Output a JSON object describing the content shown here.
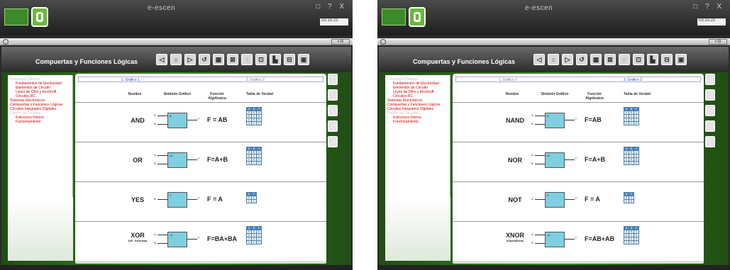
{
  "app_brand": "e-escen",
  "window_buttons": "□ ? X",
  "toolbar_zoom": "◐⊟",
  "lesson_title": "Compuertas y Funciones Lógicas",
  "nav_buttons": [
    "◁",
    "⌂",
    "▷",
    "↺",
    "▦",
    "⊠",
    "◌",
    "⊡",
    "▙",
    "⊟",
    "▣"
  ],
  "headers": {
    "name": "Nombre",
    "symbol": "Símbolo Gráfico",
    "function": "Función Algebraica",
    "table": "Tabla de Verdad"
  },
  "sidebar": [
    {
      "text": "Conceptos Básicos",
      "cls": "g"
    },
    {
      "text": "Fundamentos de Electricidad",
      "cls": "s"
    },
    {
      "text": "Elementos de Circuito",
      "cls": "s"
    },
    {
      "text": "Leyes de Ohm y Kirchhoff",
      "cls": "s"
    },
    {
      "text": "Circuitos RC",
      "cls": "s"
    },
    {
      "text": "Sistemas Electrónicos",
      "cls": ""
    },
    {
      "text": "Compuertas y Funciones Lógicas",
      "cls": ""
    },
    {
      "text": "Circuitos Integrados Digitales",
      "cls": ""
    },
    {
      "text": "Diseño de Circuitos",
      "cls": "g"
    },
    {
      "text": "Estructura Interna",
      "cls": "s"
    },
    {
      "text": "Funcionamiento",
      "cls": "s"
    }
  ],
  "screens": [
    {
      "timer": "03:15:22",
      "tabs": [
        "1. Gráfico 1",
        "2. Gráfico 2"
      ],
      "active_tab": 0,
      "gates": [
        {
          "name": "AND",
          "sub": "",
          "box": "&",
          "expr": "F = AB",
          "rows": [
            [
              "A",
              "B",
              "F"
            ],
            [
              "0",
              "0",
              "0"
            ],
            [
              "0",
              "1",
              "0"
            ],
            [
              "1",
              "0",
              "0"
            ],
            [
              "1",
              "1",
              "1"
            ]
          ]
        },
        {
          "name": "OR",
          "sub": "",
          "box": "≥1",
          "expr": "F=A+B",
          "rows": [
            [
              "A",
              "B",
              "F"
            ],
            [
              "0",
              "0",
              "0"
            ],
            [
              "0",
              "1",
              "1"
            ],
            [
              "1",
              "0",
              "1"
            ],
            [
              "1",
              "1",
              "1"
            ]
          ]
        },
        {
          "name": "YES",
          "sub": "",
          "box": "1",
          "expr": "F = A",
          "rows": [
            [
              "A",
              "F"
            ],
            [
              "0",
              "0"
            ],
            [
              "1",
              "1"
            ]
          ]
        },
        {
          "name": "XOR",
          "sub": "(OR - Exclusiva)",
          "box": "=1",
          "expr": "F=BA+BA",
          "rows": [
            [
              "A",
              "B",
              "F"
            ],
            [
              "0",
              "0",
              "0"
            ],
            [
              "0",
              "1",
              "1"
            ],
            [
              "1",
              "0",
              "1"
            ],
            [
              "1",
              "1",
              "0"
            ]
          ]
        }
      ]
    },
    {
      "timer": "03:15:22",
      "tabs": [
        "1. Gráfico 1",
        "2. Gráfico 2"
      ],
      "active_tab": 1,
      "gates": [
        {
          "name": "NAND",
          "sub": "",
          "box": "&",
          "expr": "F=AB",
          "rows": [
            [
              "A",
              "B",
              "F"
            ],
            [
              "0",
              "0",
              "1"
            ],
            [
              "0",
              "1",
              "1"
            ],
            [
              "1",
              "0",
              "1"
            ],
            [
              "1",
              "1",
              "0"
            ]
          ]
        },
        {
          "name": "NOR",
          "sub": "",
          "box": "≥1",
          "expr": "F=A+B",
          "rows": [
            [
              "A",
              "B",
              "F"
            ],
            [
              "0",
              "0",
              "1"
            ],
            [
              "0",
              "1",
              "0"
            ],
            [
              "1",
              "0",
              "0"
            ],
            [
              "1",
              "1",
              "0"
            ]
          ]
        },
        {
          "name": "NOT",
          "sub": "",
          "box": "1",
          "expr": "F = A",
          "rows": [
            [
              "A",
              "F"
            ],
            [
              "0",
              "1"
            ],
            [
              "1",
              "0"
            ]
          ]
        },
        {
          "name": "XNOR",
          "sub": "(Equivalencia)",
          "box": "=1",
          "expr": "F=AB+AB",
          "rows": [
            [
              "A",
              "B",
              "F"
            ],
            [
              "0",
              "0",
              "1"
            ],
            [
              "0",
              "1",
              "0"
            ],
            [
              "1",
              "0",
              "0"
            ],
            [
              "1",
              "1",
              "1"
            ]
          ]
        }
      ]
    }
  ]
}
